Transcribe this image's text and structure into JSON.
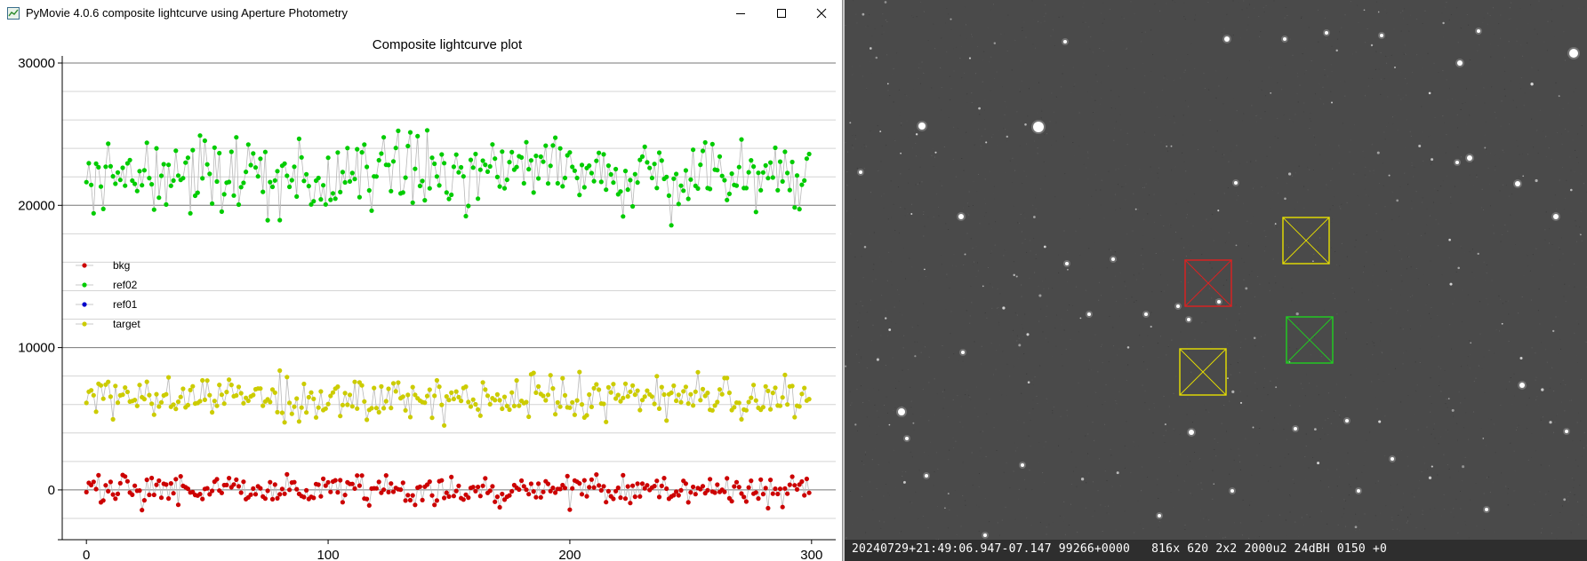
{
  "window": {
    "title": "PyMovie 4.0.6 composite lightcurve using Aperture Photometry",
    "icon": "chart-window-icon",
    "controls": [
      "minimize-icon",
      "maximize-icon",
      "close-icon"
    ]
  },
  "chart_data": {
    "type": "scatter",
    "title": "Composite lightcurve plot",
    "xlim": [
      -10,
      310
    ],
    "ylim": [
      -3000,
      30000
    ],
    "xticks": [
      0,
      100,
      200,
      300
    ],
    "yticks": [
      0,
      10000,
      20000,
      30000
    ],
    "ytick_labels": [
      "0",
      "10000",
      "20000",
      "30000"
    ],
    "grid": true,
    "legend_position": "left",
    "connected_by_thin_gray_lines": true,
    "series": [
      {
        "name": "bkg",
        "color": "#cc0000",
        "mean": 0,
        "spread": 800,
        "range": [
          -2000,
          2000
        ]
      },
      {
        "name": "ref02",
        "color": "#00cc00",
        "mean": 22000,
        "spread": 2000,
        "range": [
          16500,
          28500
        ]
      },
      {
        "name": "ref01",
        "color": "#0000cc",
        "mean": null,
        "spread": null,
        "range": null
      },
      {
        "name": "target",
        "color": "#cccc00",
        "mean": 6500,
        "spread": 1200,
        "range": [
          3300,
          9100
        ]
      }
    ],
    "n_points": 300
  },
  "camera": {
    "timestamp": "20240729+21:49:06.947-07.147 99266+0000   816x 620 2x2 2000u2 24dBH 0150 +0",
    "apertures": [
      {
        "label": "red aperture",
        "color": "#e02020"
      },
      {
        "label": "yellow aperture 1",
        "color": "#e8e000"
      },
      {
        "label": "yellow aperture 2",
        "color": "#e8e000"
      },
      {
        "label": "green aperture",
        "color": "#20d020"
      }
    ]
  }
}
